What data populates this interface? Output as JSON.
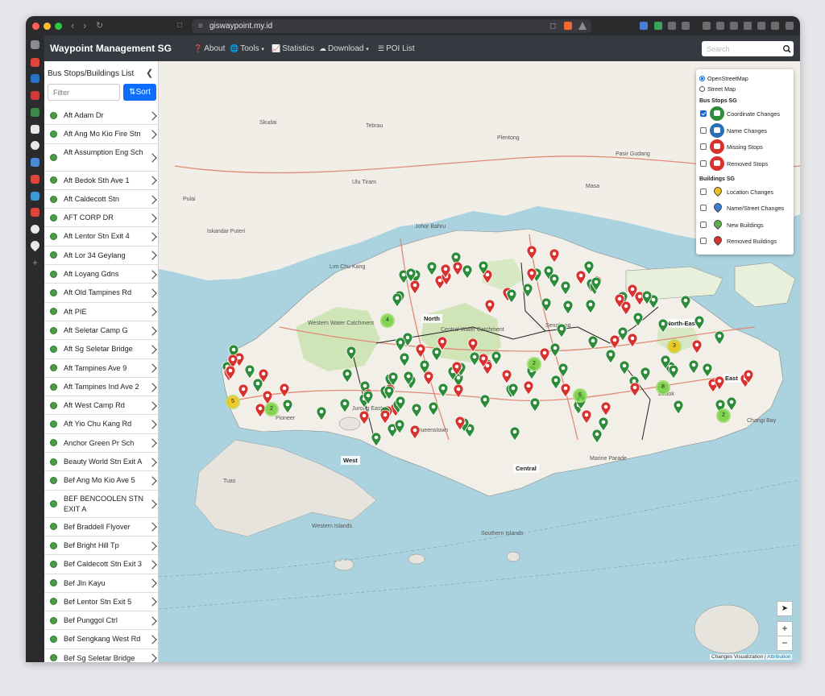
{
  "browser": {
    "url": "giswaypoint.my.id"
  },
  "header": {
    "brand": "Waypoint Management SG",
    "nav": [
      {
        "label": "About",
        "icon": "question-circle-icon"
      },
      {
        "label": "Tools",
        "icon": "globe-icon"
      },
      {
        "label": "Statistics",
        "icon": "chart-icon"
      },
      {
        "label": "Download",
        "icon": "cloud-download-icon"
      },
      {
        "label": "POI List",
        "icon": "list-icon"
      }
    ],
    "search_placeholder": "Search"
  },
  "sidebar": {
    "title": "Bus Stops/Buildings List",
    "filter_placeholder": "Filter",
    "sort_label": "Sort",
    "items": [
      "Aft Adam Dr",
      "Aft Ang Mo Kio Fire Stn",
      "Aft Assumption Eng Sch",
      "Aft Bedok Sth Ave 1",
      "Aft Caldecott Stn",
      "AFT CORP DR",
      "Aft Lentor Stn Exit 4",
      "Aft Lor 34 Geylang",
      "Aft Loyang Gdns",
      "Aft Old Tampines Rd",
      "Aft PIE",
      "Aft Seletar Camp G",
      "Aft Sg Seletar Bridge",
      "Aft Tampines Ave 9",
      "Aft Tampines Ind Ave 2",
      "Aft West Camp Rd",
      "Aft Yio Chu Kang Rd",
      "Anchor Green Pr Sch",
      "Beauty World Stn Exit A",
      "Bef Ang Mo Kio Ave 5",
      "BEF BENCOOLEN STN EXIT A",
      "Bef Braddell Flyover",
      "Bef Bright Hill Tp",
      "Bef Caldecott Stn Exit 3",
      "Bef Jln Kayu",
      "Bef Lentor Stn Exit 5",
      "Bef Punggol Ctrl",
      "Bef Sengkang West Rd",
      "Bef Sg Seletar Bridge"
    ]
  },
  "layers": {
    "base": [
      {
        "label": "OpenStreetMap",
        "selected": true
      },
      {
        "label": "Street Map",
        "selected": false
      }
    ],
    "bus_heading": "Bus Stops SG",
    "bus": [
      {
        "label": "Coordinate Changes",
        "checked": true,
        "color": "#2e8b3a"
      },
      {
        "label": "Name Changes",
        "checked": false,
        "color": "#2a6fb5"
      },
      {
        "label": "Missing Stops",
        "checked": false,
        "color": "#d8322f"
      },
      {
        "label": "Removed Stops",
        "checked": false,
        "color": "#d8322f"
      }
    ],
    "buildings_heading": "Buildings SG",
    "buildings": [
      {
        "label": "Location Changes",
        "checked": false,
        "color": "#e8c11c"
      },
      {
        "label": "Name/Street Changes",
        "checked": false,
        "color": "#3b7fd0"
      },
      {
        "label": "New Buildings",
        "checked": false,
        "color": "#5bb04a"
      },
      {
        "label": "Removed Buildings",
        "checked": false,
        "color": "#d8322f"
      }
    ]
  },
  "map": {
    "regions": [
      "North",
      "North-East",
      "East",
      "West",
      "Central"
    ],
    "places": [
      "Tebrau",
      "Skudai",
      "Johor Bahru",
      "Iskandar Puteri",
      "Masa",
      "Pasir Gudang",
      "Plentong",
      "Lim Chu Kang",
      "Western Water Catchment",
      "Central Water Catchment",
      "Pioneer",
      "Jurong East",
      "Tuas",
      "Queenstown",
      "Marine Parade",
      "Changi Bay",
      "Western Islands",
      "Southern Islands",
      "Pulai",
      "Sengkang",
      "Bedok",
      "Ulu Tiram"
    ],
    "cluster_counts": [
      "4",
      "2",
      "5",
      "2",
      "6",
      "8",
      "3",
      "2"
    ],
    "attribution_text": "Changes Visualization",
    "attribution_link": "Attribution"
  },
  "colors": {
    "accent": "#0d6efd",
    "header_bg": "#343a40",
    "marker_green": "#2e8b3a",
    "marker_red": "#d8322f"
  }
}
